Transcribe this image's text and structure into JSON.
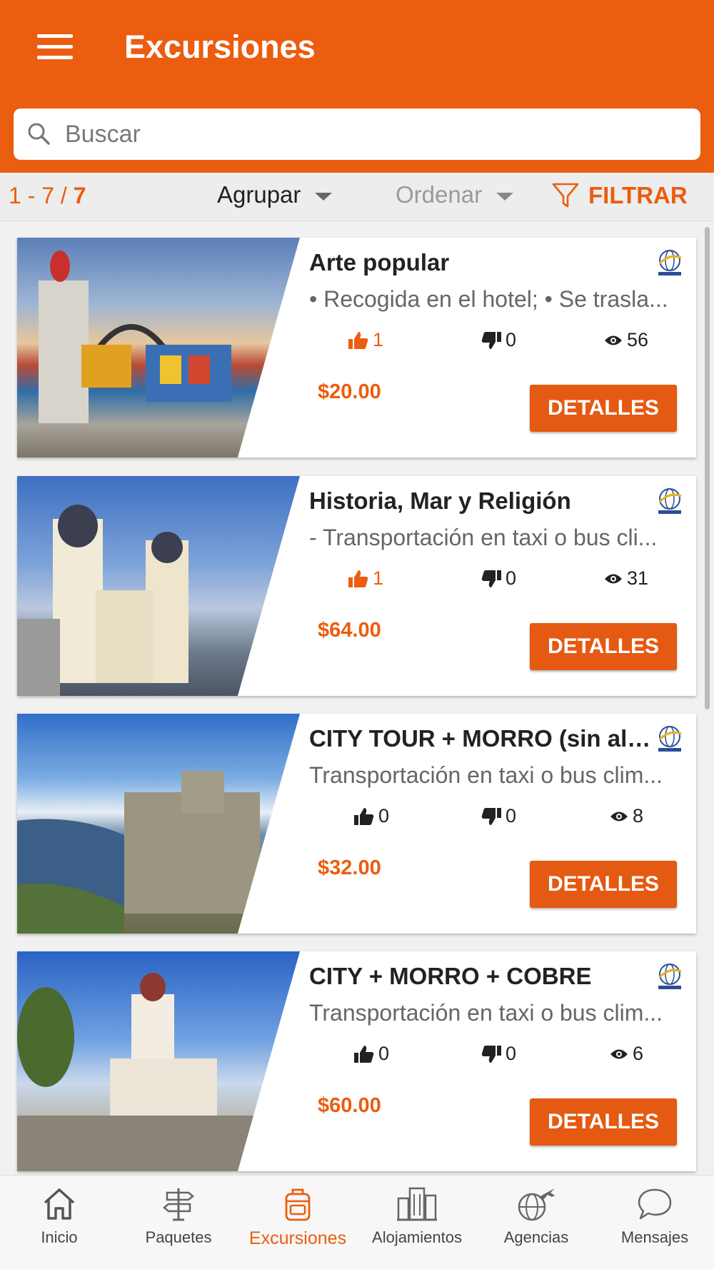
{
  "header": {
    "title": "Excursiones"
  },
  "search": {
    "placeholder": "Buscar"
  },
  "toolbar": {
    "range_start": "1 - 7 / ",
    "range_total": "7",
    "group_label": "Agrupar",
    "order_label": "Ordenar",
    "filter_label": "FILTRAR"
  },
  "cards": [
    {
      "title": "Arte popular",
      "description": "• Recogida en el hotel; • Se trasla...",
      "likes": "1",
      "dislikes": "0",
      "views": "56",
      "price": "$20.00",
      "button": "DETALLES",
      "liked": true
    },
    {
      "title": "Historia, Mar y Religión",
      "description": "- Transportación en taxi o bus cli...",
      "likes": "1",
      "dislikes": "0",
      "views": "31",
      "price": "$64.00",
      "button": "DETALLES",
      "liked": true
    },
    {
      "title": "CITY TOUR + MORRO (sin almuerzo)",
      "description": "Transportación en taxi o bus clim...",
      "likes": "0",
      "dislikes": "0",
      "views": "8",
      "price": "$32.00",
      "button": "DETALLES",
      "liked": false
    },
    {
      "title": "CITY + MORRO + COBRE",
      "description": "Transportación en taxi o bus clim...",
      "likes": "0",
      "dislikes": "0",
      "views": "6",
      "price": "$60.00",
      "button": "DETALLES",
      "liked": false
    }
  ],
  "nav": [
    {
      "label": "Inicio",
      "icon": "home-icon"
    },
    {
      "label": "Paquetes",
      "icon": "signpost-icon"
    },
    {
      "label": "Excursiones",
      "icon": "backpack-icon",
      "active": true
    },
    {
      "label": "Alojamientos",
      "icon": "buildings-icon"
    },
    {
      "label": "Agencias",
      "icon": "globe-plane-icon"
    },
    {
      "label": "Mensajes",
      "icon": "chat-icon"
    }
  ],
  "colors": {
    "accent": "#eb5d0f",
    "button": "#e45a12"
  }
}
